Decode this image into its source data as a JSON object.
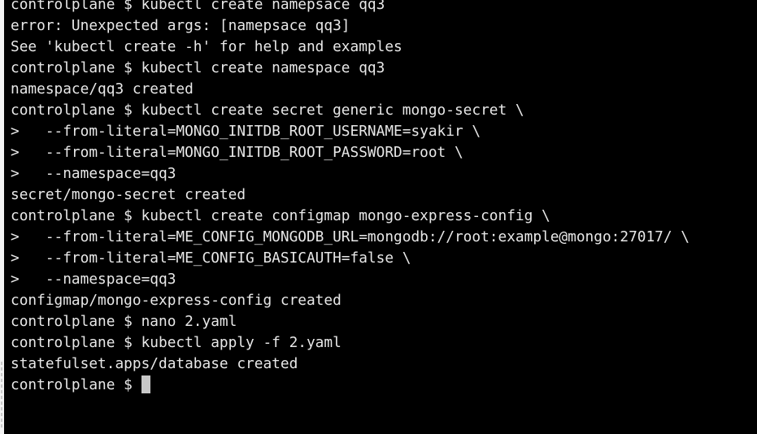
{
  "terminal": {
    "lines": [
      "controlplane $ kubectl create namepsace qq3",
      "error: Unexpected args: [namepsace qq3]",
      "See 'kubectl create -h' for help and examples",
      "controlplane $ kubectl create namespace qq3",
      "namespace/qq3 created",
      "controlplane $ kubectl create secret generic mongo-secret \\",
      ">   --from-literal=MONGO_INITDB_ROOT_USERNAME=syakir \\",
      ">   --from-literal=MONGO_INITDB_ROOT_PASSWORD=root \\",
      ">   --namespace=qq3",
      "secret/mongo-secret created",
      "controlplane $ kubectl create configmap mongo-express-config \\",
      ">   --from-literal=ME_CONFIG_MONGODB_URL=mongodb://root:example@mongo:27017/ \\",
      ">   --from-literal=ME_CONFIG_BASICAUTH=false \\",
      ">   --namespace=qq3",
      "configmap/mongo-express-config created",
      "controlplane $ nano 2.yaml",
      "controlplane $ kubectl apply -f 2.yaml",
      "statefulset.apps/database created"
    ],
    "prompt": "controlplane $ ",
    "text_color": "#e8e8e8",
    "background_color": "#000000",
    "cursor_color": "#c8c8c8"
  }
}
